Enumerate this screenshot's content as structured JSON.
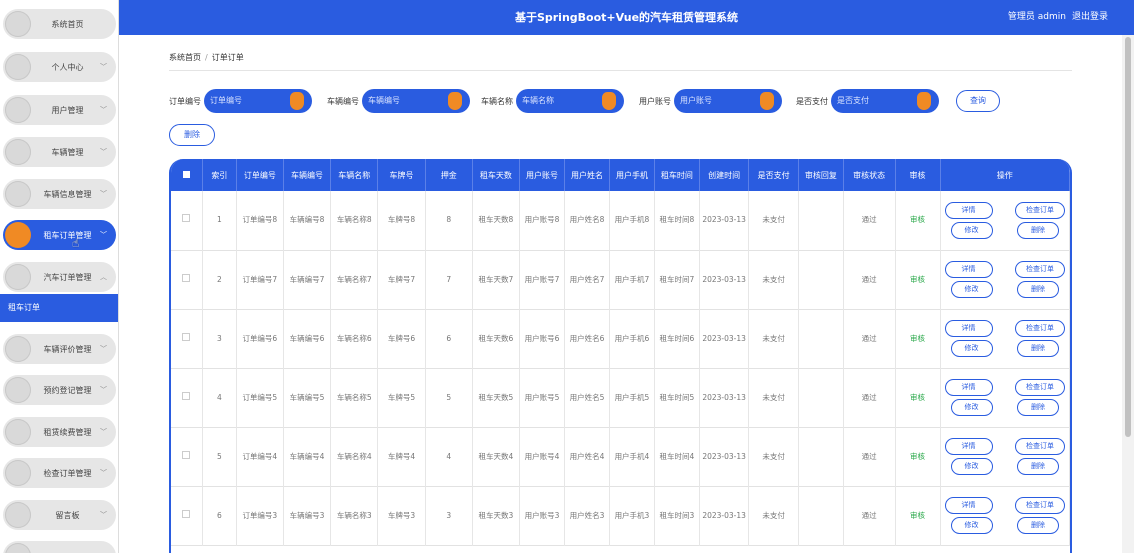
{
  "header": {
    "title": "基于SpringBoot+Vue的汽车租赁管理系统",
    "user_label": "管理员 admin",
    "logout_label": "退出登录"
  },
  "sidebar": {
    "items": [
      {
        "label": "系统首页",
        "active": false,
        "chevron": false
      },
      {
        "label": "个人中心",
        "active": false,
        "chevron": true
      },
      {
        "label": "用户管理",
        "active": false,
        "chevron": true
      },
      {
        "label": "车辆管理",
        "active": false,
        "chevron": true
      },
      {
        "label": "车辆信息管理",
        "active": false,
        "chevron": true
      },
      {
        "label": "租车订单管理",
        "active": true,
        "chevron": true
      },
      {
        "label": "汽车订单管理",
        "active": false,
        "chevron": true
      },
      {
        "label": "车辆评价管理",
        "active": false,
        "chevron": true
      },
      {
        "label": "预约登记管理",
        "active": false,
        "chevron": true
      },
      {
        "label": "租赁续费管理",
        "active": false,
        "chevron": true
      },
      {
        "label": "检查订单管理",
        "active": false,
        "chevron": true
      },
      {
        "label": "留言板",
        "active": false,
        "chevron": true
      }
    ],
    "sub_item": "租车订单"
  },
  "breadcrumb": {
    "home": "系统首页",
    "current": "订单订单"
  },
  "filters": [
    {
      "label": "订单编号",
      "placeholder": "订单编号"
    },
    {
      "label": "车辆编号",
      "placeholder": "车辆编号"
    },
    {
      "label": "车辆名称",
      "placeholder": "车辆名称"
    },
    {
      "label": "用户账号",
      "placeholder": "用户账号"
    },
    {
      "label": "是否支付",
      "placeholder": "是否支付"
    }
  ],
  "buttons": {
    "search": "查询",
    "delete": "删除"
  },
  "table": {
    "columns": [
      "索引",
      "订单编号",
      "车辆编号",
      "车辆名称",
      "车牌号",
      "押金",
      "租车天数",
      "用户账号",
      "用户姓名",
      "用户手机",
      "租车时间",
      "创建时间",
      "是否支付",
      "审核回复",
      "审核状态",
      "审核",
      "操作"
    ],
    "rows": [
      {
        "index": "1",
        "order_no": "订单编号8",
        "car_no": "车辆编号8",
        "car_name": "车辆名称8",
        "plate": "车牌号8",
        "deposit": "8",
        "days": "租车天数8",
        "account": "用户账号8",
        "name": "用户姓名8",
        "phone": "用户手机8",
        "rent_time": "租车时间8",
        "created": "2023-03-13",
        "paid": "未支付",
        "reply": "",
        "status": "通过",
        "audit": "审核"
      },
      {
        "index": "2",
        "order_no": "订单编号7",
        "car_no": "车辆编号7",
        "car_name": "车辆名称7",
        "plate": "车牌号7",
        "deposit": "7",
        "days": "租车天数7",
        "account": "用户账号7",
        "name": "用户姓名7",
        "phone": "用户手机7",
        "rent_time": "租车时间7",
        "created": "2023-03-13",
        "paid": "未支付",
        "reply": "",
        "status": "通过",
        "audit": "审核"
      },
      {
        "index": "3",
        "order_no": "订单编号6",
        "car_no": "车辆编号6",
        "car_name": "车辆名称6",
        "plate": "车牌号6",
        "deposit": "6",
        "days": "租车天数6",
        "account": "用户账号6",
        "name": "用户姓名6",
        "phone": "用户手机6",
        "rent_time": "租车时间6",
        "created": "2023-03-13",
        "paid": "未支付",
        "reply": "",
        "status": "通过",
        "audit": "审核"
      },
      {
        "index": "4",
        "order_no": "订单编号5",
        "car_no": "车辆编号5",
        "car_name": "车辆名称5",
        "plate": "车牌号5",
        "deposit": "5",
        "days": "租车天数5",
        "account": "用户账号5",
        "name": "用户姓名5",
        "phone": "用户手机5",
        "rent_time": "租车时间5",
        "created": "2023-03-13",
        "paid": "未支付",
        "reply": "",
        "status": "通过",
        "audit": "审核"
      },
      {
        "index": "5",
        "order_no": "订单编号4",
        "car_no": "车辆编号4",
        "car_name": "车辆名称4",
        "plate": "车牌号4",
        "deposit": "4",
        "days": "租车天数4",
        "account": "用户账号4",
        "name": "用户姓名4",
        "phone": "用户手机4",
        "rent_time": "租车时间4",
        "created": "2023-03-13",
        "paid": "未支付",
        "reply": "",
        "status": "通过",
        "audit": "审核"
      },
      {
        "index": "6",
        "order_no": "订单编号3",
        "car_no": "车辆编号3",
        "car_name": "车辆名称3",
        "plate": "车牌号3",
        "deposit": "3",
        "days": "租车天数3",
        "account": "用户账号3",
        "name": "用户姓名3",
        "phone": "用户手机3",
        "rent_time": "租车时间3",
        "created": "2023-03-13",
        "paid": "未支付",
        "reply": "",
        "status": "通过",
        "audit": "审核"
      }
    ],
    "actions": {
      "detail": "详情",
      "check_order": "检查订单",
      "edit": "修改",
      "delete": "删除"
    }
  },
  "colors": {
    "primary": "#2a5ce0",
    "accent": "#f08a24",
    "success": "#2aa84a"
  }
}
